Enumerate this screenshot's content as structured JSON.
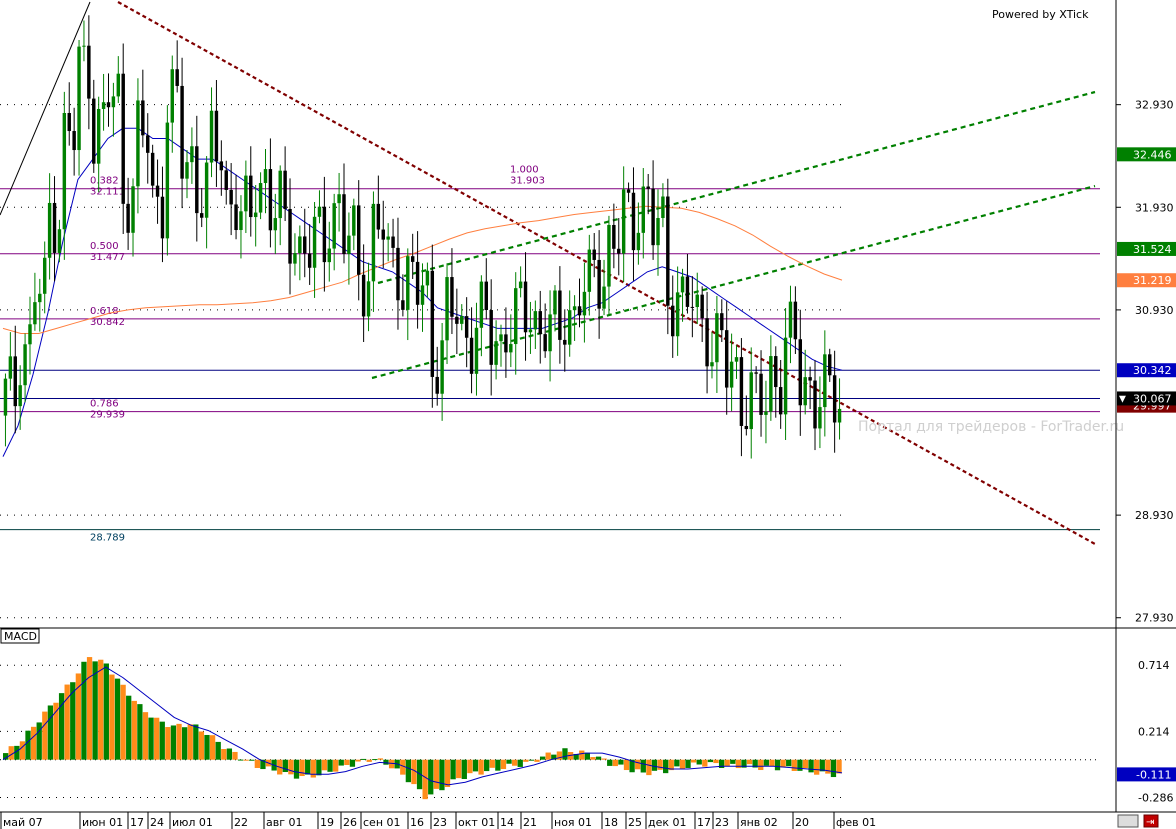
{
  "app": {
    "watermark": "Powered by XTick",
    "site_watermark": "Портал для трейдеров - ForTrader.ru"
  },
  "colors": {
    "background": "#ffffff",
    "bull_candle": "#008000",
    "bear_candle": "#000000",
    "ma_fast": "#0000c0",
    "ma_slow": "#ff7f3f",
    "fib_line": "#800080",
    "trend_down": "#800000",
    "channel": "#008000",
    "h_line_blue": "#000080",
    "macd_pos": "#008000",
    "macd_neg": "#ff8c1a",
    "macd_signal": "#0000c0",
    "current_price_tag": "#000000",
    "tag_green": "#008000",
    "tag_orange": "#ff7f3f",
    "tag_blue": "#0000c0",
    "tag_darkred": "#800000"
  },
  "price_axis": {
    "ticks": [
      "32.930",
      "31.930",
      "30.930",
      "28.930",
      "27.930"
    ]
  },
  "price_tags": [
    {
      "label": "32.446",
      "price": 32.446,
      "color": "tag_green"
    },
    {
      "label": "31.524",
      "price": 31.524,
      "color": "tag_green"
    },
    {
      "label": "31.219",
      "price": 31.219,
      "color": "tag_orange"
    },
    {
      "label": "30.342",
      "price": 30.342,
      "color": "tag_blue"
    },
    {
      "label": "29.997",
      "price": 29.997,
      "color": "tag_darkred"
    },
    {
      "label": "30.067",
      "price": 30.067,
      "color": "current_price_tag"
    }
  ],
  "time_axis": {
    "labels": [
      "май 07",
      "июн 01",
      "17",
      "24",
      "июл 01",
      "22",
      "авг 01",
      "19",
      "26",
      "сен 01",
      "16",
      "23",
      "окт 01",
      "14",
      "21",
      "ноя 01",
      "18",
      "25",
      "дек 01",
      "17",
      "23",
      "янв 02",
      "20",
      "фев 01"
    ]
  },
  "fib_levels": [
    {
      "ratio": "0.382",
      "price_label": "32.111",
      "price": 32.111
    },
    {
      "ratio": "0.500",
      "price_label": "31.477",
      "price": 31.477
    },
    {
      "ratio": "0.618",
      "price_label": "30.842",
      "price": 30.842
    },
    {
      "ratio": "0.786",
      "price_label": "29.939",
      "price": 29.939
    },
    {
      "ratio": "1.000",
      "price_label": "31.903",
      "price": 32.22
    }
  ],
  "extra_levels": [
    {
      "label": "28.789",
      "price": 28.789
    }
  ],
  "macd_panel": {
    "title": "MACD",
    "ticks": [
      "0.714",
      "0.214",
      "-0.286"
    ],
    "current_tag": "-0.111"
  },
  "chart_data": [
    {
      "type": "candlestick",
      "title": "",
      "price_range": [
        27.83,
        33.95
      ],
      "series_close": [
        30.1,
        30.6,
        31.1,
        31.9,
        32.6,
        33.3,
        32.7,
        33.0,
        32.1,
        32.6,
        32.0,
        32.9,
        32.4,
        32.1,
        32.5,
        32.0,
        31.8,
        32.2,
        31.9,
        31.7,
        31.5,
        31.6,
        31.9,
        31.6,
        31.3,
        31.7,
        31.4,
        31.2,
        31.1,
        30.5,
        30.9,
        30.7,
        30.8,
        30.6,
        30.8,
        30.9,
        30.8,
        30.7,
        30.9,
        31.1,
        31.3,
        31.6,
        31.8,
        32.0,
        31.7,
        31.1,
        31.0,
        30.8,
        30.6,
        30.3,
        30.1,
        30.0,
        30.3,
        30.6,
        30.2,
        30.1,
        30.067
      ],
      "series_ma_fast": [
        29.5,
        29.8,
        30.3,
        30.9,
        31.6,
        32.2,
        32.4,
        32.6,
        32.7,
        32.7,
        32.6,
        32.6,
        32.5,
        32.4,
        32.4,
        32.3,
        32.2,
        32.1,
        32.0,
        31.9,
        31.8,
        31.7,
        31.6,
        31.5,
        31.4,
        31.35,
        31.3,
        31.2,
        31.1,
        30.95,
        30.9,
        30.85,
        30.8,
        30.75,
        30.75,
        30.75,
        30.75,
        30.8,
        30.85,
        30.95,
        31.0,
        31.1,
        31.2,
        31.3,
        31.35,
        31.3,
        31.25,
        31.15,
        31.05,
        30.95,
        30.85,
        30.75,
        30.65,
        30.55,
        30.45,
        30.38,
        30.342
      ],
      "series_ma_slow": [
        30.75,
        30.7,
        30.7,
        30.75,
        30.8,
        30.85,
        30.9,
        30.93,
        30.95,
        30.96,
        30.97,
        30.98,
        30.98,
        30.99,
        31.0,
        31.02,
        31.05,
        31.1,
        31.15,
        31.2,
        31.28,
        31.35,
        31.42,
        31.48,
        31.55,
        31.62,
        31.68,
        31.72,
        31.75,
        31.78,
        31.8,
        31.83,
        31.86,
        31.88,
        31.9,
        31.92,
        31.94,
        31.93,
        31.92,
        31.88,
        31.82,
        31.75,
        31.66,
        31.55,
        31.45,
        31.36,
        31.28,
        31.22
      ],
      "volume": []
    },
    {
      "type": "bar",
      "title": "MACD",
      "value_range": [
        -0.38,
        0.98
      ],
      "histogram": [
        0.05,
        0.15,
        0.3,
        0.45,
        0.6,
        0.78,
        0.72,
        0.55,
        0.4,
        0.3,
        0.25,
        0.27,
        0.2,
        0.1,
        0.02,
        -0.05,
        -0.08,
        -0.12,
        -0.13,
        -0.1,
        -0.06,
        -0.02,
        0.01,
        -0.05,
        -0.15,
        -0.28,
        -0.22,
        -0.14,
        -0.1,
        -0.08,
        -0.05,
        -0.03,
        0.02,
        0.07,
        0.06,
        0.04,
        -0.03,
        -0.07,
        -0.1,
        -0.09,
        -0.07,
        -0.04,
        -0.03,
        -0.05,
        -0.05,
        -0.06,
        -0.06,
        -0.07,
        -0.09,
        -0.111
      ],
      "signal": [
        0.0,
        0.08,
        0.2,
        0.35,
        0.5,
        0.62,
        0.7,
        0.62,
        0.52,
        0.42,
        0.32,
        0.26,
        0.22,
        0.15,
        0.08,
        0.0,
        -0.05,
        -0.09,
        -0.11,
        -0.11,
        -0.09,
        -0.05,
        -0.02,
        -0.03,
        -0.08,
        -0.16,
        -0.19,
        -0.17,
        -0.13,
        -0.1,
        -0.07,
        -0.04,
        0.0,
        0.03,
        0.05,
        0.05,
        0.02,
        -0.02,
        -0.05,
        -0.07,
        -0.07,
        -0.06,
        -0.05,
        -0.05,
        -0.05,
        -0.05,
        -0.06,
        -0.07,
        -0.08,
        -0.1
      ],
      "ticks": [
        "0.714",
        "0.214",
        "-0.286"
      ]
    }
  ]
}
